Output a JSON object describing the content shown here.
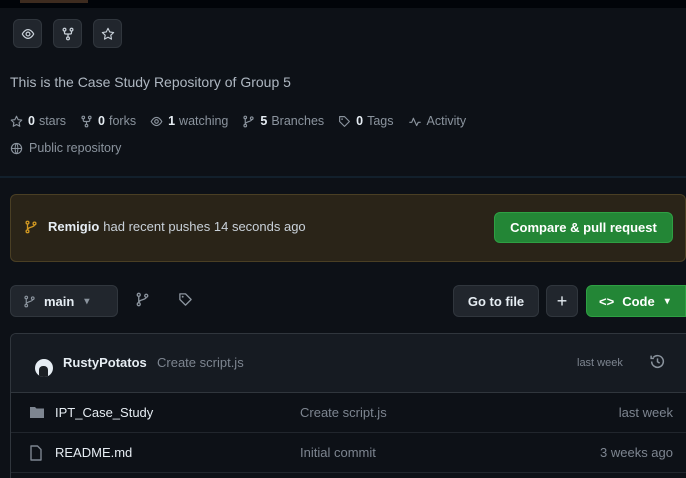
{
  "actions": {
    "watch_icon": "eye-icon",
    "fork_icon": "fork-icon",
    "star_icon": "star-icon"
  },
  "description": "This is the Case Study Repository of Group 5",
  "stats": {
    "stars_count": "0",
    "stars_label": "stars",
    "forks_count": "0",
    "forks_label": "forks",
    "watching_count": "1",
    "watching_label": "watching",
    "branches_count": "5",
    "branches_label": "Branches",
    "tags_count": "0",
    "tags_label": "Tags",
    "activity_label": "Activity"
  },
  "visibility": "Public repository",
  "push_banner": {
    "user": "Remigio",
    "text": "had recent pushes 14 seconds ago",
    "button_label": "Compare & pull request"
  },
  "toolbar": {
    "branch_name": "main",
    "goto_file_label": "Go to file",
    "add_label": "+",
    "code_label": "Code"
  },
  "latest_commit": {
    "author": "RustyPotatos",
    "message": "Create script.js",
    "time": "last week"
  },
  "files": [
    {
      "name": "IPT_Case_Study",
      "type": "folder",
      "commit": "Create script.js",
      "time": "last week"
    },
    {
      "name": "README.md",
      "type": "file",
      "commit": "Initial commit",
      "time": "3 weeks ago"
    }
  ],
  "colors": {
    "background": "#0d1117",
    "accent_green": "#238636",
    "banner_bg": "#2a2418",
    "branch_icon_yellow": "#d29922"
  }
}
